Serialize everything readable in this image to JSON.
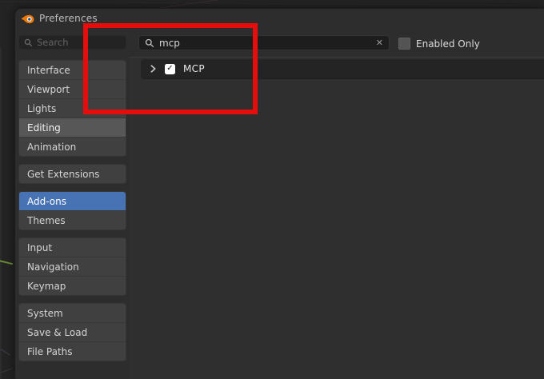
{
  "window": {
    "title": "Preferences"
  },
  "sidebar": {
    "search_placeholder": "Search",
    "groups": [
      {
        "items": [
          {
            "label": "Interface",
            "state": "normal"
          },
          {
            "label": "Viewport",
            "state": "normal"
          },
          {
            "label": "Lights",
            "state": "normal"
          },
          {
            "label": "Editing",
            "state": "hover"
          },
          {
            "label": "Animation",
            "state": "normal"
          }
        ]
      },
      {
        "items": [
          {
            "label": "Get Extensions",
            "state": "normal"
          }
        ]
      },
      {
        "items": [
          {
            "label": "Add-ons",
            "state": "selected"
          },
          {
            "label": "Themes",
            "state": "normal"
          }
        ]
      },
      {
        "items": [
          {
            "label": "Input",
            "state": "normal"
          },
          {
            "label": "Navigation",
            "state": "normal"
          },
          {
            "label": "Keymap",
            "state": "normal"
          }
        ]
      },
      {
        "items": [
          {
            "label": "System",
            "state": "normal"
          },
          {
            "label": "Save & Load",
            "state": "normal"
          },
          {
            "label": "File Paths",
            "state": "normal"
          }
        ]
      }
    ]
  },
  "main": {
    "search": {
      "value": "mcp",
      "clear_icon": "✕"
    },
    "enabled_only": {
      "label": "Enabled Only",
      "checked": false
    },
    "addons": [
      {
        "name": "MCP",
        "enabled": true,
        "expanded": false,
        "check_icon": "✓"
      }
    ]
  },
  "colors": {
    "selected_blue": "#4772b3",
    "annotation_red": "#e60d0d",
    "addon_row_bg": "#242424",
    "window_bg": "#2d2d2d"
  }
}
